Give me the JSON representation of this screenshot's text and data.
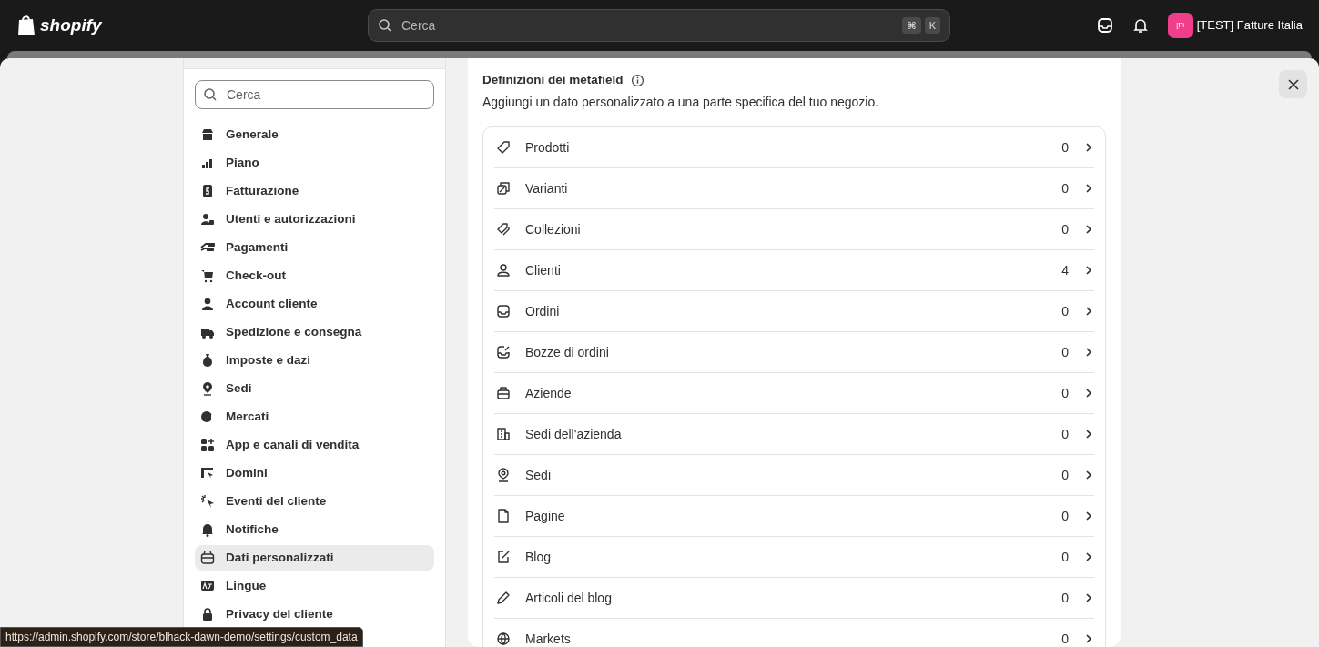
{
  "topbar": {
    "logo": "shopify",
    "search": {
      "placeholder": "Cerca"
    },
    "shortcut_keys": [
      "⌘",
      "K"
    ],
    "store": {
      "initials": "[Fi",
      "name": "[TEST] Fatture Italia"
    }
  },
  "sidebar": {
    "search": {
      "placeholder": "Cerca"
    },
    "items": [
      {
        "label": "Generale",
        "selected": false
      },
      {
        "label": "Piano",
        "selected": false
      },
      {
        "label": "Fatturazione",
        "selected": false
      },
      {
        "label": "Utenti e autorizzazioni",
        "selected": false
      },
      {
        "label": "Pagamenti",
        "selected": false
      },
      {
        "label": "Check-out",
        "selected": false
      },
      {
        "label": "Account cliente",
        "selected": false
      },
      {
        "label": "Spedizione e consegna",
        "selected": false
      },
      {
        "label": "Imposte e dazi",
        "selected": false
      },
      {
        "label": "Sedi",
        "selected": false
      },
      {
        "label": "Mercati",
        "selected": false
      },
      {
        "label": "App e canali di vendita",
        "selected": false
      },
      {
        "label": "Domini",
        "selected": false
      },
      {
        "label": "Eventi del cliente",
        "selected": false
      },
      {
        "label": "Notifiche",
        "selected": false
      },
      {
        "label": "Dati personalizzati",
        "selected": true
      },
      {
        "label": "Lingue",
        "selected": false
      },
      {
        "label": "Privacy del cliente",
        "selected": false
      }
    ]
  },
  "main": {
    "title": "Definizioni dei metafield",
    "description": "Aggiungi un dato personalizzato a una parte specifica del tuo negozio.",
    "rows": [
      {
        "label": "Prodotti",
        "count": "0"
      },
      {
        "label": "Varianti",
        "count": "0"
      },
      {
        "label": "Collezioni",
        "count": "0"
      },
      {
        "label": "Clienti",
        "count": "4"
      },
      {
        "label": "Ordini",
        "count": "0"
      },
      {
        "label": "Bozze di ordini",
        "count": "0"
      },
      {
        "label": "Aziende",
        "count": "0"
      },
      {
        "label": "Sedi dell'azienda",
        "count": "0"
      },
      {
        "label": "Sedi",
        "count": "0"
      },
      {
        "label": "Pagine",
        "count": "0"
      },
      {
        "label": "Blog",
        "count": "0"
      },
      {
        "label": "Articoli del blog",
        "count": "0"
      },
      {
        "label": "Markets",
        "count": "0"
      }
    ]
  },
  "status_url": "https://admin.shopify.com/store/blhack-dawn-demo/settings/custom_data"
}
